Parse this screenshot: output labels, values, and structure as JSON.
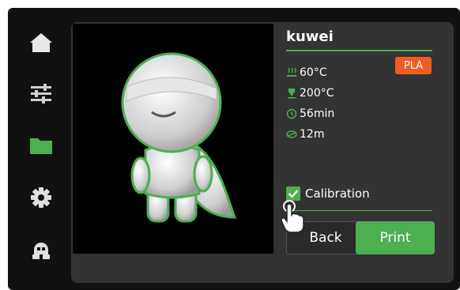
{
  "nav": [
    {
      "name": "home",
      "icon": "home-icon"
    },
    {
      "name": "settings-sliders",
      "icon": "sliders-icon"
    },
    {
      "name": "files",
      "icon": "folder-icon",
      "active": true
    },
    {
      "name": "system",
      "icon": "gear-icon"
    },
    {
      "name": "assistant",
      "icon": "robot-icon"
    }
  ],
  "file": {
    "name": "kuwei",
    "bed_temp": "60°C",
    "nozzle_temp": "200°C",
    "duration": "56min",
    "filament_length": "12m",
    "material": "PLA"
  },
  "calibration": {
    "label": "Calibration",
    "checked": true
  },
  "buttons": {
    "back": "Back",
    "print": "Print"
  },
  "colors": {
    "accent": "#4caf50",
    "material_badge": "#f25c1f",
    "background": "#111111",
    "panel": "#333333"
  }
}
